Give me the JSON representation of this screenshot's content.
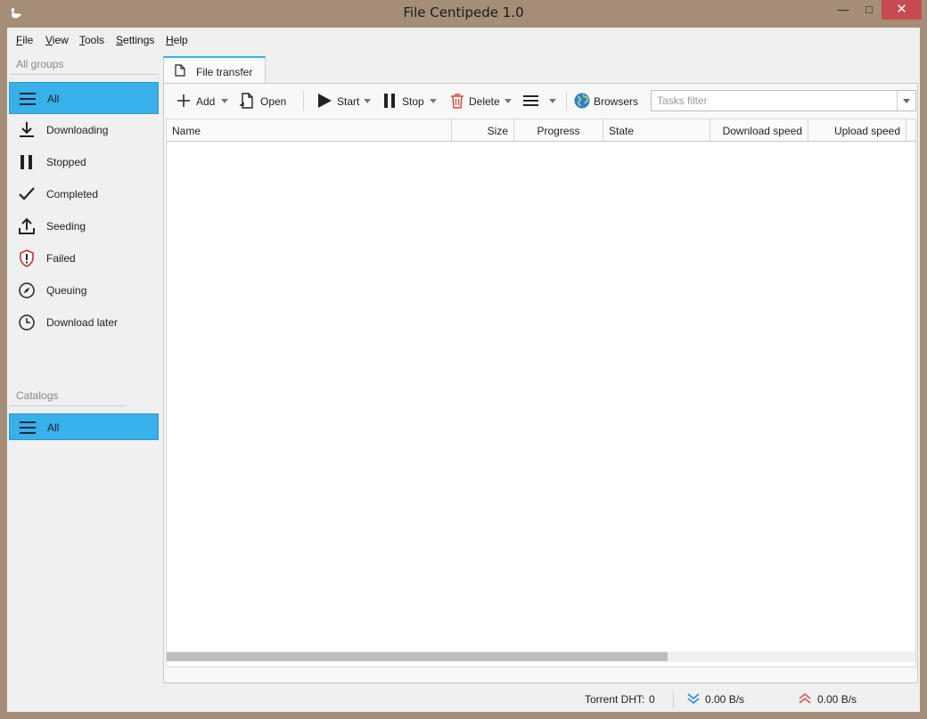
{
  "window": {
    "title": "File Centipede 1.0",
    "minimize": "—",
    "maximize": "□",
    "close": "✕"
  },
  "menu": [
    {
      "label": "File",
      "mnemonic": "F",
      "rest": "ile"
    },
    {
      "label": "View",
      "mnemonic": "V",
      "rest": "iew"
    },
    {
      "label": "Tools",
      "mnemonic": "T",
      "rest": "ools"
    },
    {
      "label": "Settings",
      "mnemonic": "S",
      "rest": "ettings"
    },
    {
      "label": "Help",
      "mnemonic": "H",
      "rest": "elp"
    }
  ],
  "sidebar": {
    "groups_header": "All groups",
    "groups": [
      {
        "label": "All",
        "icon": "list-icon",
        "selected": true
      },
      {
        "label": "Downloading",
        "icon": "download-icon",
        "selected": false
      },
      {
        "label": "Stopped",
        "icon": "pause-icon",
        "selected": false
      },
      {
        "label": "Completed",
        "icon": "checkmark-icon",
        "selected": false
      },
      {
        "label": "Seeding",
        "icon": "upload-icon",
        "selected": false
      },
      {
        "label": "Failed",
        "icon": "shield-alert-icon",
        "selected": false
      },
      {
        "label": "Queuing",
        "icon": "compass-icon",
        "selected": false
      },
      {
        "label": "Download later",
        "icon": "clock-icon",
        "selected": false
      }
    ],
    "catalogs_header": "Catalogs",
    "catalogs_add": "+",
    "catalogs": [
      {
        "label": "All",
        "icon": "list-icon",
        "selected": true
      }
    ]
  },
  "tabs": [
    {
      "label": "File transfer",
      "icon": "document-icon",
      "active": true
    }
  ],
  "toolbar": {
    "add": "Add",
    "open": "Open",
    "start": "Start",
    "stop": "Stop",
    "delete": "Delete",
    "browsers": "Browsers",
    "filter_placeholder": "Tasks filter",
    "filter_value": ""
  },
  "table": {
    "columns": [
      "Name",
      "Size",
      "Progress",
      "State",
      "Download speed",
      "Upload speed"
    ],
    "rows": [],
    "scroll_fraction": 0.67
  },
  "status": {
    "dht_label": "Torrent DHT:",
    "dht_value": "0",
    "download_speed": "0.00 B/s",
    "upload_speed": "0.00 B/s"
  },
  "colors": {
    "accent": "#38b0ea",
    "titlebar": "#a58e77",
    "close": "#c74b50",
    "delete_icon": "#e0443e",
    "failed_icon": "#c8302b",
    "browsers_icon": "#2d7fd3",
    "download_arrow": "#2a8ad4",
    "upload_arrow": "#d9534f"
  }
}
